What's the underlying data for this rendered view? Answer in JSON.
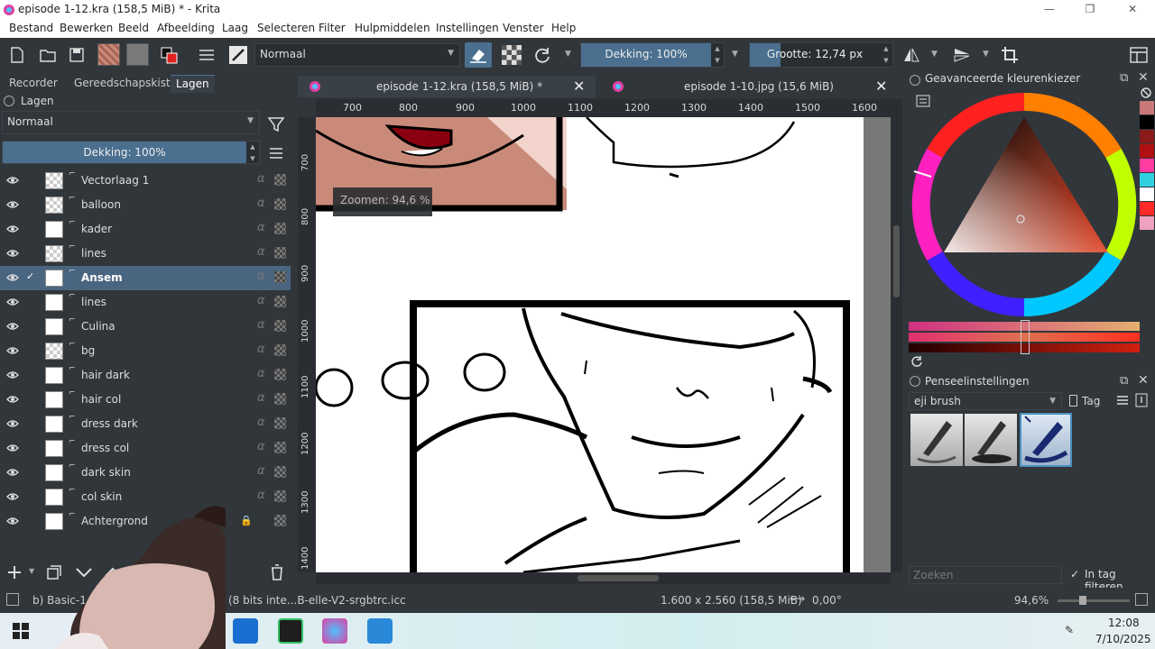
{
  "window": {
    "title": "episode 1-12.kra (158,5 MiB) * - Krita",
    "minimize": "—",
    "restore": "❐",
    "close": "✕"
  },
  "menu": [
    {
      "label": "Bestand"
    },
    {
      "label": "Bewerken"
    },
    {
      "label": "Beeld"
    },
    {
      "label": "Afbeelding"
    },
    {
      "label": "Laag"
    },
    {
      "label": "Selecteren"
    },
    {
      "label": "Filter"
    },
    {
      "label": "Hulpmiddelen"
    },
    {
      "label": "Instellingen"
    },
    {
      "label": "Venster"
    },
    {
      "label": "Help"
    }
  ],
  "toolbar": {
    "blend_mode": "Normaal",
    "opacity_label": "Dekking: 100%",
    "opacity_value": 100,
    "size_label": "Grootte: 12,74 px"
  },
  "left_dock": {
    "tabs": [
      "Recorder",
      "Gereedschapskist",
      "Lagen"
    ],
    "active_tab": "Lagen",
    "panel_title": "Lagen",
    "blend_mode": "Normaal",
    "opacity_label": "Dekking:  100%",
    "layers": [
      {
        "name": "Vectorlaag 1",
        "selected": false,
        "checked": false,
        "thumb": "checker",
        "locked": false
      },
      {
        "name": "balloon",
        "selected": false,
        "checked": false,
        "thumb": "checker",
        "locked": false
      },
      {
        "name": "kader",
        "selected": false,
        "checked": false,
        "thumb": "white",
        "locked": false
      },
      {
        "name": "lines",
        "selected": false,
        "checked": false,
        "thumb": "checker",
        "locked": false
      },
      {
        "name": "Ansem",
        "selected": true,
        "checked": true,
        "thumb": "white",
        "locked": false
      },
      {
        "name": "lines",
        "selected": false,
        "checked": false,
        "thumb": "white",
        "locked": false
      },
      {
        "name": "Culina",
        "selected": false,
        "checked": false,
        "thumb": "white",
        "locked": false
      },
      {
        "name": "bg",
        "selected": false,
        "checked": false,
        "thumb": "checker",
        "locked": false
      },
      {
        "name": "hair dark",
        "selected": false,
        "checked": false,
        "thumb": "white",
        "locked": false
      },
      {
        "name": "hair col",
        "selected": false,
        "checked": false,
        "thumb": "white",
        "locked": false
      },
      {
        "name": "dress dark",
        "selected": false,
        "checked": false,
        "thumb": "white",
        "locked": false
      },
      {
        "name": "dress col",
        "selected": false,
        "checked": false,
        "thumb": "white",
        "locked": false
      },
      {
        "name": "dark skin",
        "selected": false,
        "checked": false,
        "thumb": "white",
        "locked": false
      },
      {
        "name": "col skin",
        "selected": false,
        "checked": false,
        "thumb": "white",
        "locked": false
      },
      {
        "name": "Achtergrond",
        "selected": false,
        "checked": false,
        "thumb": "white",
        "locked": true
      }
    ],
    "lock_glyph": "🔓",
    "alpha_glyph": "α",
    "link_glyph": "⚲"
  },
  "documents": {
    "tabs": [
      {
        "label": "episode 1-12.kra (158,5 MiB) *",
        "active": true
      },
      {
        "label": "episode 1-10.jpg (15,6 MiB)",
        "active": false
      }
    ],
    "ruler_h": [
      "700",
      "800",
      "900",
      "1000",
      "1100",
      "1200",
      "1300",
      "1400",
      "1500",
      "1600"
    ],
    "ruler_v": [
      "700",
      "800",
      "900",
      "1000",
      "1100",
      "1200",
      "1300",
      "1400"
    ],
    "zoom_tooltip": "Zoomen: 94,6 %"
  },
  "right_dock": {
    "color_panel_title": "Geavanceerde kleurenkiezer",
    "brush_panel_title": "Penseelinstellingen",
    "brush_tag": "eji brush",
    "tag_button": "Tag",
    "search_placeholder": "Zoeken",
    "filter_label": "In tag filteren",
    "swatches": [
      "#c87878",
      "#000000",
      "#8b1a1a",
      "#b01010",
      "#ff3aa0",
      "#30d0e0",
      "#ffffff",
      "#ff2a2a",
      "#f0a0c0"
    ]
  },
  "status": {
    "brush": "b) Basic-1",
    "profile": "(8 bits inte...B-elle-V2-srgbtrc.icc",
    "dimensions": "1.600 x 2.560 (158,5 MiB)",
    "rotation": "0,00°",
    "zoom": "94,6%"
  },
  "taskbar": {
    "time": "12:08",
    "date": "7/10/2025"
  },
  "colors": {
    "accent": "#4a6f8f",
    "panel": "#31363b",
    "selected_row": "#4a6580"
  }
}
